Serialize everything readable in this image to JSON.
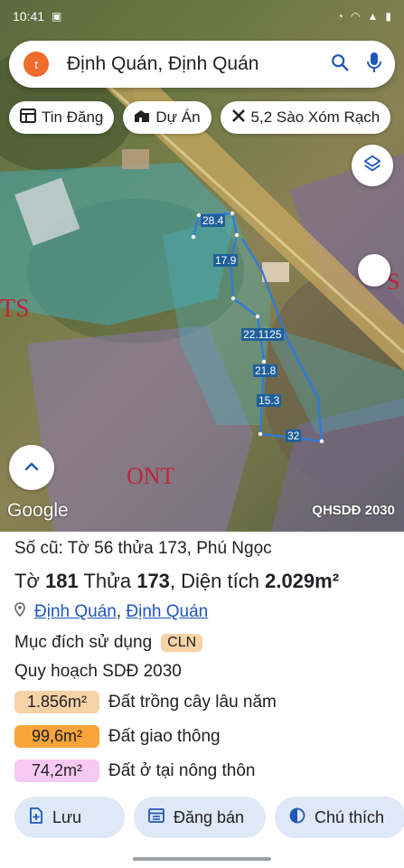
{
  "status": {
    "time": "10:41"
  },
  "search": {
    "avatar_letter": "t",
    "text": "Định Quán, Định Quán"
  },
  "chips": [
    {
      "icon": "table-icon",
      "label": "Tin Đăng"
    },
    {
      "icon": "building-icon",
      "label": "Dự Án"
    },
    {
      "icon": "tools-icon",
      "label": "5,2 Sào Xóm Rạch"
    }
  ],
  "map": {
    "dimensions": [
      "28.4",
      "17.9",
      "22.1125",
      "21.8",
      "15.3",
      "32"
    ],
    "attribution": "Google",
    "plan_tag": "QHSDĐ 2030"
  },
  "info": {
    "old_record": "Số cũ: Tờ 56 thửa 173, Phú Ngọc",
    "sheet_label": "Tờ",
    "sheet": "181",
    "parcel_label": "Thửa",
    "parcel": "173",
    "area_label": ", Diện tích",
    "area": "2.029m²",
    "location_district": "Định Quán",
    "location_separator": ",",
    "location_town": "Định Quán",
    "purpose_label": "Mục đích sử dụng",
    "purpose_code": "CLN",
    "plan_label": "Quy hoạch SDĐ 2030",
    "land_uses": [
      {
        "area": "1.856m²",
        "label": "Đất trồng cây lâu năm",
        "color": "#f6d2a6"
      },
      {
        "area": "99,6m²",
        "label": "Đất giao thông",
        "color": "#f7a43a"
      },
      {
        "area": "74,2m²",
        "label": "Đất ở tại nông thôn",
        "color": "#f7c8f2"
      }
    ]
  },
  "actions": [
    {
      "icon": "add-document-icon",
      "label": "Lưu"
    },
    {
      "icon": "calendar-icon",
      "label": "Đăng bán"
    },
    {
      "icon": "half-circle-icon",
      "label": "Chú thích"
    }
  ]
}
